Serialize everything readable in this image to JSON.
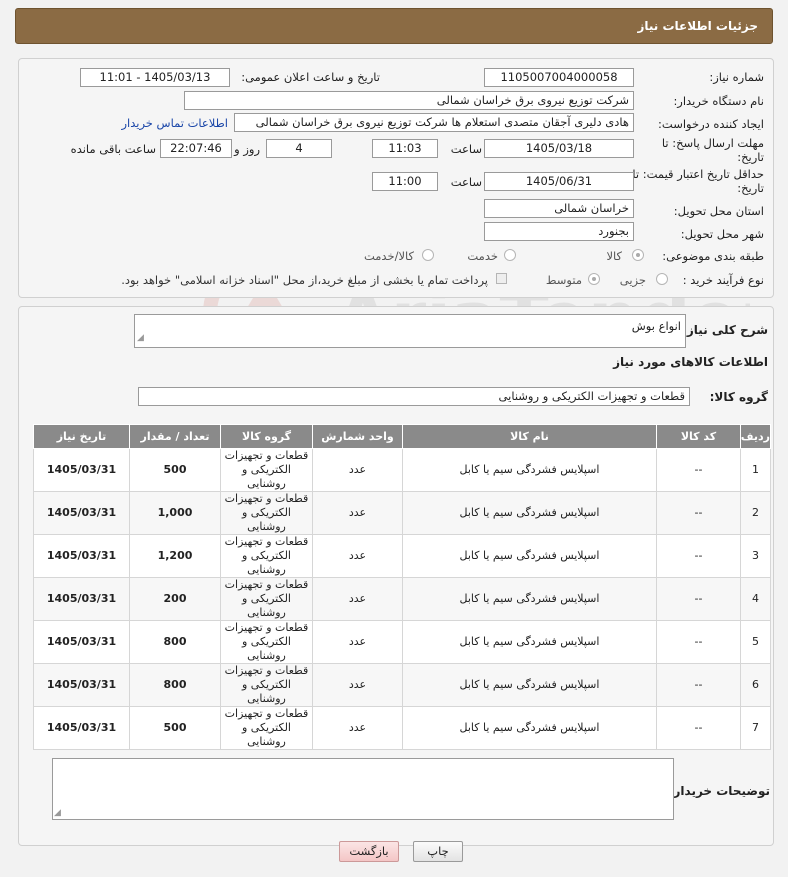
{
  "header": {
    "title": "جزئیات اطلاعات نیاز"
  },
  "form": {
    "need_number_label": "شماره نیاز:",
    "need_number": "1105007004000058",
    "announce_label": "تاریخ و ساعت اعلان عمومی:",
    "announce_value": "1405/03/13 - 11:01",
    "buyer_label": "نام دستگاه خریدار:",
    "buyer_value": "شرکت توزیع نیروی برق خراسان شمالی",
    "creator_label": "ایجاد کننده درخواست:",
    "creator_value": "هادی دلیری آجقان متصدی استعلام ها شرکت توزیع نیروی برق خراسان شمالی",
    "contact_link": "اطلاعات تماس خریدار",
    "deadline_label": "مهلت ارسال پاسخ: تا تاریخ:",
    "deadline_date": "1405/03/18",
    "time_label": "ساعت",
    "deadline_time": "11:03",
    "days_value": "4",
    "days_label": "روز و",
    "remaining_time": "22:07:46",
    "remaining_label": "ساعت باقی مانده",
    "validity_label": "حداقل تاریخ اعتبار قیمت: تا تاریخ:",
    "validity_date": "1405/06/31",
    "validity_time": "11:00",
    "province_label": "استان محل تحویل:",
    "province_value": "خراسان شمالی",
    "city_label": "شهر محل تحویل:",
    "city_value": "بجنورد",
    "category_label": "طبقه بندی موضوعی:",
    "category_options": [
      "کالا",
      "خدمت",
      "کالا/خدمت"
    ],
    "process_label": "نوع فرآیند خرید :",
    "process_options": [
      "جزیی",
      "متوسط"
    ],
    "payment_note": "پرداخت تمام یا بخشی از مبلغ خرید،از محل \"اسناد خزانه اسلامی\" خواهد بود."
  },
  "details": {
    "description_label": "شرح کلی نیاز:",
    "description_value": "انواع بوش",
    "goods_heading": "اطلاعات کالاهای مورد نیاز",
    "group_label": "گروه کالا:",
    "group_value": "قطعات و تجهیزات الکتریکی و روشنایی"
  },
  "table": {
    "headers": [
      "ردیف",
      "کد کالا",
      "نام کالا",
      "واحد شمارش",
      "گروه کالا",
      "تعداد / مقدار",
      "تاریخ نیاز"
    ],
    "rows": [
      [
        "1",
        "--",
        "اسپلایس فشردگی سیم یا کابل",
        "عدد",
        "قطعات و تجهیزات الکتریکی و روشنایی",
        "500",
        "1405/03/31"
      ],
      [
        "2",
        "--",
        "اسپلایس فشردگی سیم یا کابل",
        "عدد",
        "قطعات و تجهیزات الکتریکی و روشنایی",
        "1,000",
        "1405/03/31"
      ],
      [
        "3",
        "--",
        "اسپلایس فشردگی سیم یا کابل",
        "عدد",
        "قطعات و تجهیزات الکتریکی و روشنایی",
        "1,200",
        "1405/03/31"
      ],
      [
        "4",
        "--",
        "اسپلایس فشردگی سیم یا کابل",
        "عدد",
        "قطعات و تجهیزات الکتریکی و روشنایی",
        "200",
        "1405/03/31"
      ],
      [
        "5",
        "--",
        "اسپلایس فشردگی سیم یا کابل",
        "عدد",
        "قطعات و تجهیزات الکتریکی و روشنایی",
        "800",
        "1405/03/31"
      ],
      [
        "6",
        "--",
        "اسپلایس فشردگی سیم یا کابل",
        "عدد",
        "قطعات و تجهیزات الکتریکی و روشنایی",
        "800",
        "1405/03/31"
      ],
      [
        "7",
        "--",
        "اسپلایس فشردگی سیم یا کابل",
        "عدد",
        "قطعات و تجهیزات الکتریکی و روشنایی",
        "500",
        "1405/03/31"
      ]
    ]
  },
  "buyer_notes": {
    "label": "توضیحات خریدار:",
    "value": ""
  },
  "buttons": {
    "print": "چاپ",
    "back": "بازگشت"
  },
  "watermark": {
    "text": "AriaTender.neT"
  },
  "colors": {
    "header_bg": "#8b6b44",
    "table_header_bg": "#8a8a8a",
    "link": "#1a46a8",
    "back_button": "#f4c6c6"
  }
}
